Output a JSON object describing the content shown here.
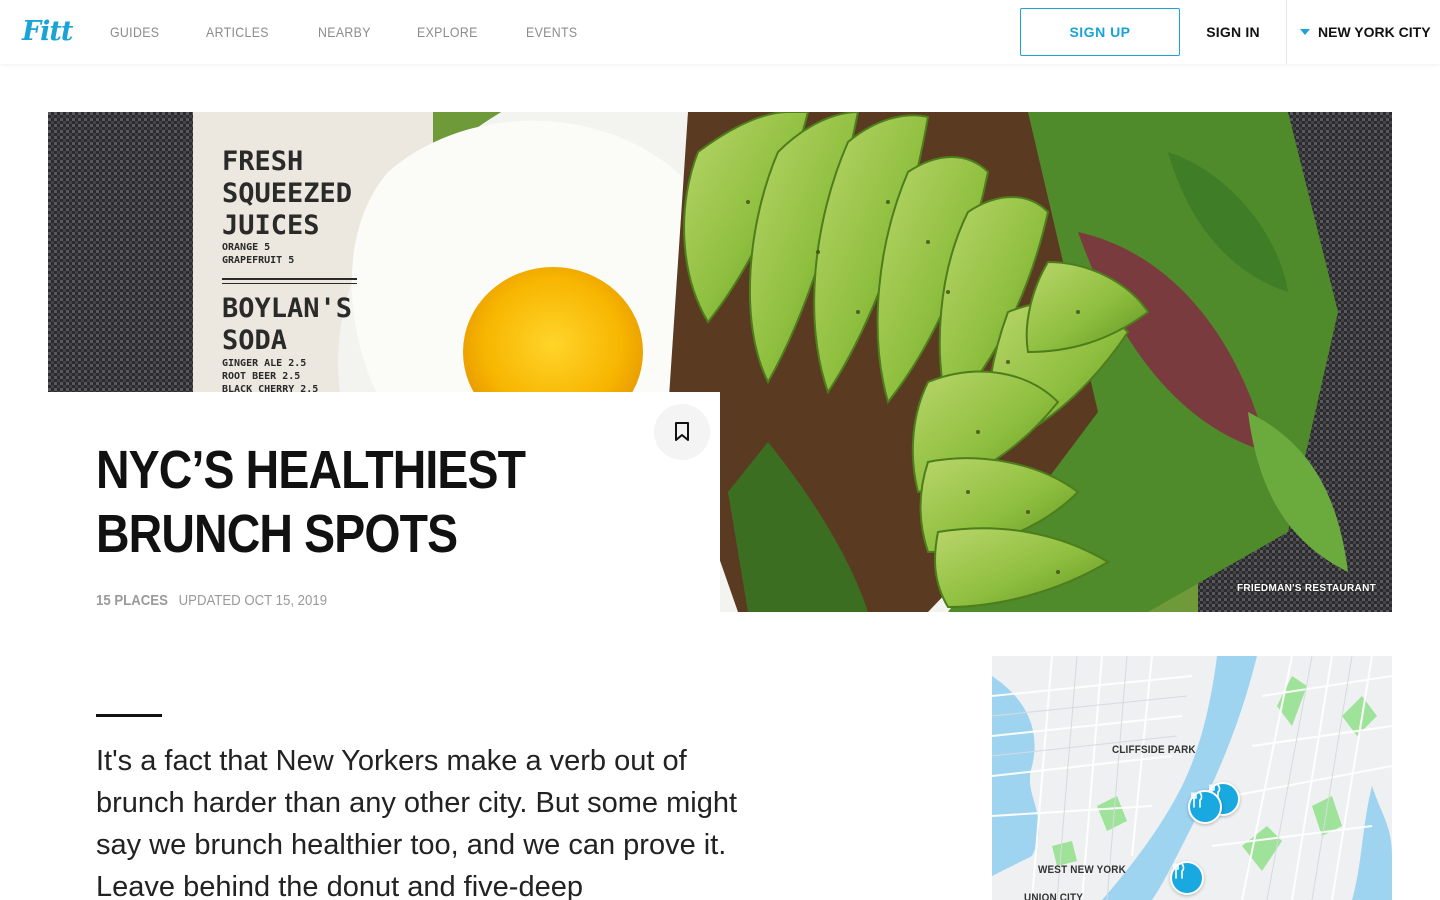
{
  "header": {
    "logo": "Fitt",
    "nav": [
      "GUIDES",
      "ARTICLES",
      "NEARBY",
      "EXPLORE",
      "EVENTS"
    ],
    "signup_label": "SIGN UP",
    "signin_label": "SIGN IN",
    "city_label": "NEW YORK CITY"
  },
  "hero": {
    "menu_text": {
      "heading1": [
        "FRESH",
        "SQUEEZED",
        "JUICES"
      ],
      "juices": [
        "ORANGE 5",
        "GRAPEFRUIT 5"
      ],
      "heading2": [
        "BOYLAN'S",
        "SODA"
      ],
      "sodas": [
        "GINGER ALE 2.5",
        "ROOT BEER 2.5",
        "BLACK CHERRY 2.5"
      ]
    },
    "photo_credit": "FRIEDMAN'S RESTAURANT"
  },
  "guide": {
    "title": "NYC’S HEALTHIEST BRUNCH SPOTS",
    "places": "15 PLACES",
    "updated": "UPDATED OCT 15, 2019"
  },
  "intro": "It's a fact that New Yorkers make a verb out of brunch harder than any other city. But some might say we brunch healthier too, and we can prove it. Leave behind the donut and five-deep",
  "map": {
    "labels": [
      "CLIFFSIDE PARK",
      "WEST NEW YORK",
      "UNION CITY"
    ]
  },
  "colors": {
    "accent": "#1aa3d6",
    "pin": "#19a8e0",
    "water": "#9ed4f0",
    "park": "#9fe39a"
  }
}
